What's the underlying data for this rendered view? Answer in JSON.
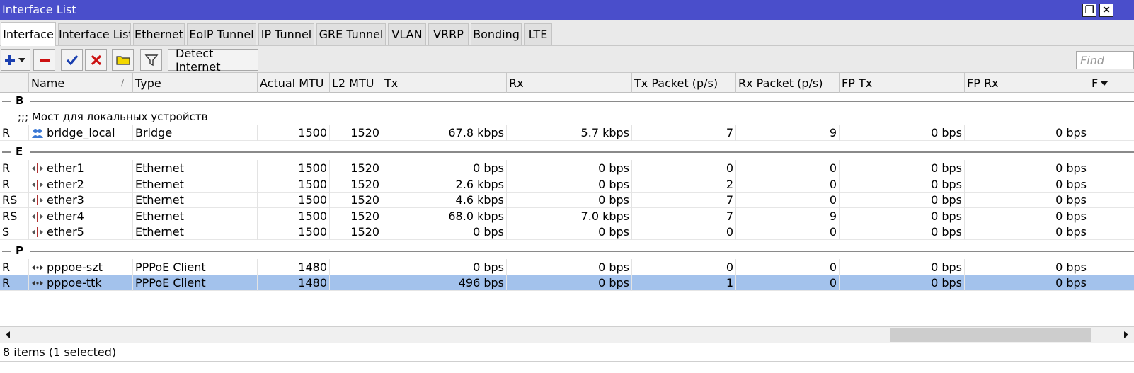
{
  "window": {
    "title": "Interface List",
    "restore_glyph": "❐",
    "close_glyph": "✕"
  },
  "tabs": [
    {
      "label": "Interface",
      "active": true
    },
    {
      "label": "Interface List"
    },
    {
      "label": "Ethernet"
    },
    {
      "label": "EoIP Tunnel"
    },
    {
      "label": "IP Tunnel"
    },
    {
      "label": "GRE Tunnel"
    },
    {
      "label": "VLAN"
    },
    {
      "label": "VRRP"
    },
    {
      "label": "Bonding"
    },
    {
      "label": "LTE"
    }
  ],
  "toolbar": {
    "detect_internet_label": "Detect Internet",
    "find_placeholder": "Find",
    "icons": [
      "add-icon",
      "chevron-down-icon",
      "remove-icon",
      "enable-check-icon",
      "disable-x-icon",
      "comment-note-icon",
      "filter-icon"
    ],
    "colors": {
      "add": "#1a3fb0",
      "remove": "#cc1111",
      "check": "#1a3fb0",
      "note": "#f4d800"
    }
  },
  "columns": {
    "flags": "",
    "name": "Name",
    "type": "Type",
    "actual_mtu": "Actual MTU",
    "l2_mtu": "L2 MTU",
    "tx": "Tx",
    "rx": "Rx",
    "tx_packet": "Tx Packet (p/s)",
    "rx_packet": "Rx Packet (p/s)",
    "fp_tx": "FP Tx",
    "fp_rx": "FP Rx",
    "more": "F"
  },
  "groups": [
    {
      "letter": "B",
      "comment": ";;; Мост для локальных устройств",
      "rows": [
        {
          "flags": "R",
          "icon": "bridge-icon",
          "name": "bridge_local",
          "type": "Bridge",
          "actual_mtu": "1500",
          "l2_mtu": "1520",
          "tx": "67.8 kbps",
          "rx": "5.7 kbps",
          "tx_packet": "7",
          "rx_packet": "9",
          "fp_tx": "0 bps",
          "fp_rx": "0 bps"
        }
      ]
    },
    {
      "letter": "E",
      "rows": [
        {
          "flags": "R",
          "icon": "ethernet-icon",
          "name": "ether1",
          "type": "Ethernet",
          "actual_mtu": "1500",
          "l2_mtu": "1520",
          "tx": "0 bps",
          "rx": "0 bps",
          "tx_packet": "0",
          "rx_packet": "0",
          "fp_tx": "0 bps",
          "fp_rx": "0 bps"
        },
        {
          "flags": "R",
          "icon": "ethernet-icon",
          "name": "ether2",
          "type": "Ethernet",
          "actual_mtu": "1500",
          "l2_mtu": "1520",
          "tx": "2.6 kbps",
          "rx": "0 bps",
          "tx_packet": "2",
          "rx_packet": "0",
          "fp_tx": "0 bps",
          "fp_rx": "0 bps"
        },
        {
          "flags": "RS",
          "icon": "ethernet-icon",
          "name": "ether3",
          "type": "Ethernet",
          "actual_mtu": "1500",
          "l2_mtu": "1520",
          "tx": "4.6 kbps",
          "rx": "0 bps",
          "tx_packet": "7",
          "rx_packet": "0",
          "fp_tx": "0 bps",
          "fp_rx": "0 bps"
        },
        {
          "flags": "RS",
          "icon": "ethernet-icon",
          "name": "ether4",
          "type": "Ethernet",
          "actual_mtu": "1500",
          "l2_mtu": "1520",
          "tx": "68.0 kbps",
          "rx": "7.0 kbps",
          "tx_packet": "7",
          "rx_packet": "9",
          "fp_tx": "0 bps",
          "fp_rx": "0 bps"
        },
        {
          "flags": "S",
          "icon": "ethernet-icon",
          "name": "ether5",
          "type": "Ethernet",
          "actual_mtu": "1500",
          "l2_mtu": "1520",
          "tx": "0 bps",
          "rx": "0 bps",
          "tx_packet": "0",
          "rx_packet": "0",
          "fp_tx": "0 bps",
          "fp_rx": "0 bps"
        }
      ]
    },
    {
      "letter": "P",
      "rows": [
        {
          "flags": "R",
          "icon": "pppoe-icon",
          "name": "pppoe-szt",
          "type": "PPPoE Client",
          "actual_mtu": "1480",
          "l2_mtu": "",
          "tx": "0 bps",
          "rx": "0 bps",
          "tx_packet": "0",
          "rx_packet": "0",
          "fp_tx": "0 bps",
          "fp_rx": "0 bps"
        },
        {
          "flags": "R",
          "icon": "pppoe-icon",
          "name": "pppoe-ttk",
          "type": "PPPoE Client",
          "actual_mtu": "1480",
          "l2_mtu": "",
          "tx": "496 bps",
          "rx": "0 bps",
          "tx_packet": "1",
          "rx_packet": "0",
          "fp_tx": "0 bps",
          "fp_rx": "0 bps",
          "selected": true
        }
      ]
    }
  ],
  "status": {
    "text": "8 items (1 selected)"
  },
  "scrollbar": {
    "left_arrow": "◀",
    "right_arrow": "▶",
    "position": 0.82
  }
}
